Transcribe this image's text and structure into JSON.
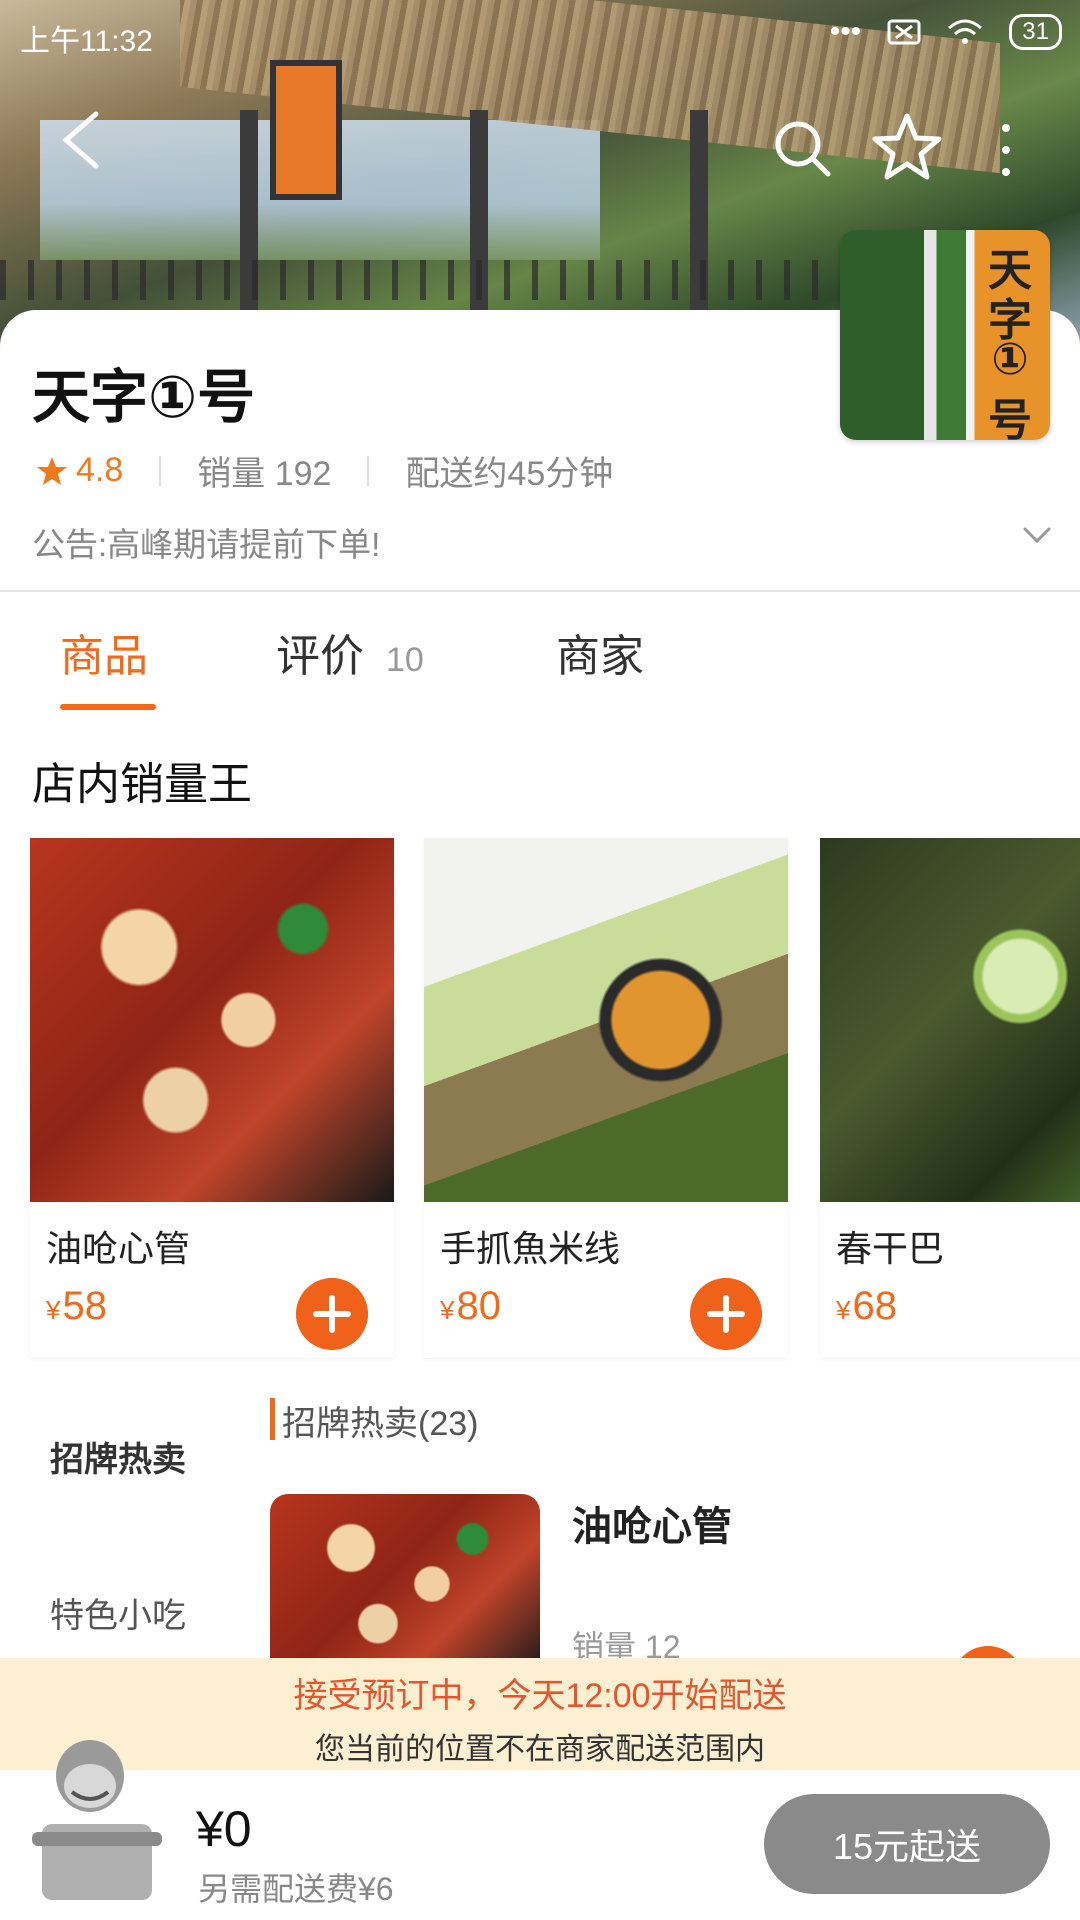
{
  "status_bar": {
    "time": "上午11:32",
    "battery": "31"
  },
  "store": {
    "name": "天字①号",
    "logo_chars": [
      "天",
      "字",
      "①",
      "号"
    ],
    "rating": "4.8",
    "sales": "销量 192",
    "delivery_time": "配送约45分钟",
    "notice": "公告:高峰期请提前下单!"
  },
  "tabs": [
    {
      "label": "商品"
    },
    {
      "label": "评价",
      "count": "10"
    },
    {
      "label": "商家"
    }
  ],
  "best_seller": {
    "title": "店内销量王",
    "items": [
      {
        "name": "油呛心管",
        "currency": "¥",
        "price": "58"
      },
      {
        "name": "手抓魚米线",
        "currency": "¥",
        "price": "80"
      },
      {
        "name": "春干巴",
        "currency": "¥",
        "price": "68"
      }
    ]
  },
  "categories": [
    "招牌热卖",
    "特色小吃"
  ],
  "menu_group": {
    "title": "招牌热卖(23)",
    "item": {
      "name": "油呛心管",
      "sales": "销量 12"
    }
  },
  "banner": {
    "line1": "接受预订中，今天12:00开始配送",
    "line2": "您当前的位置不在商家配送范围内"
  },
  "cart": {
    "total": "¥0",
    "delivery_fee": "另需配送费¥6",
    "checkout_label": "15元起送"
  },
  "colors": {
    "accent": "#f06a1a",
    "banner_bg": "#fcefd2",
    "checkout_bg": "#8a8a8a"
  },
  "icons": [
    "back-icon",
    "search-icon",
    "star-icon",
    "more-icon",
    "chevron-down-icon",
    "plus-icon",
    "rating-star-icon",
    "wifi-icon",
    "signal-icon",
    "battery-icon"
  ]
}
